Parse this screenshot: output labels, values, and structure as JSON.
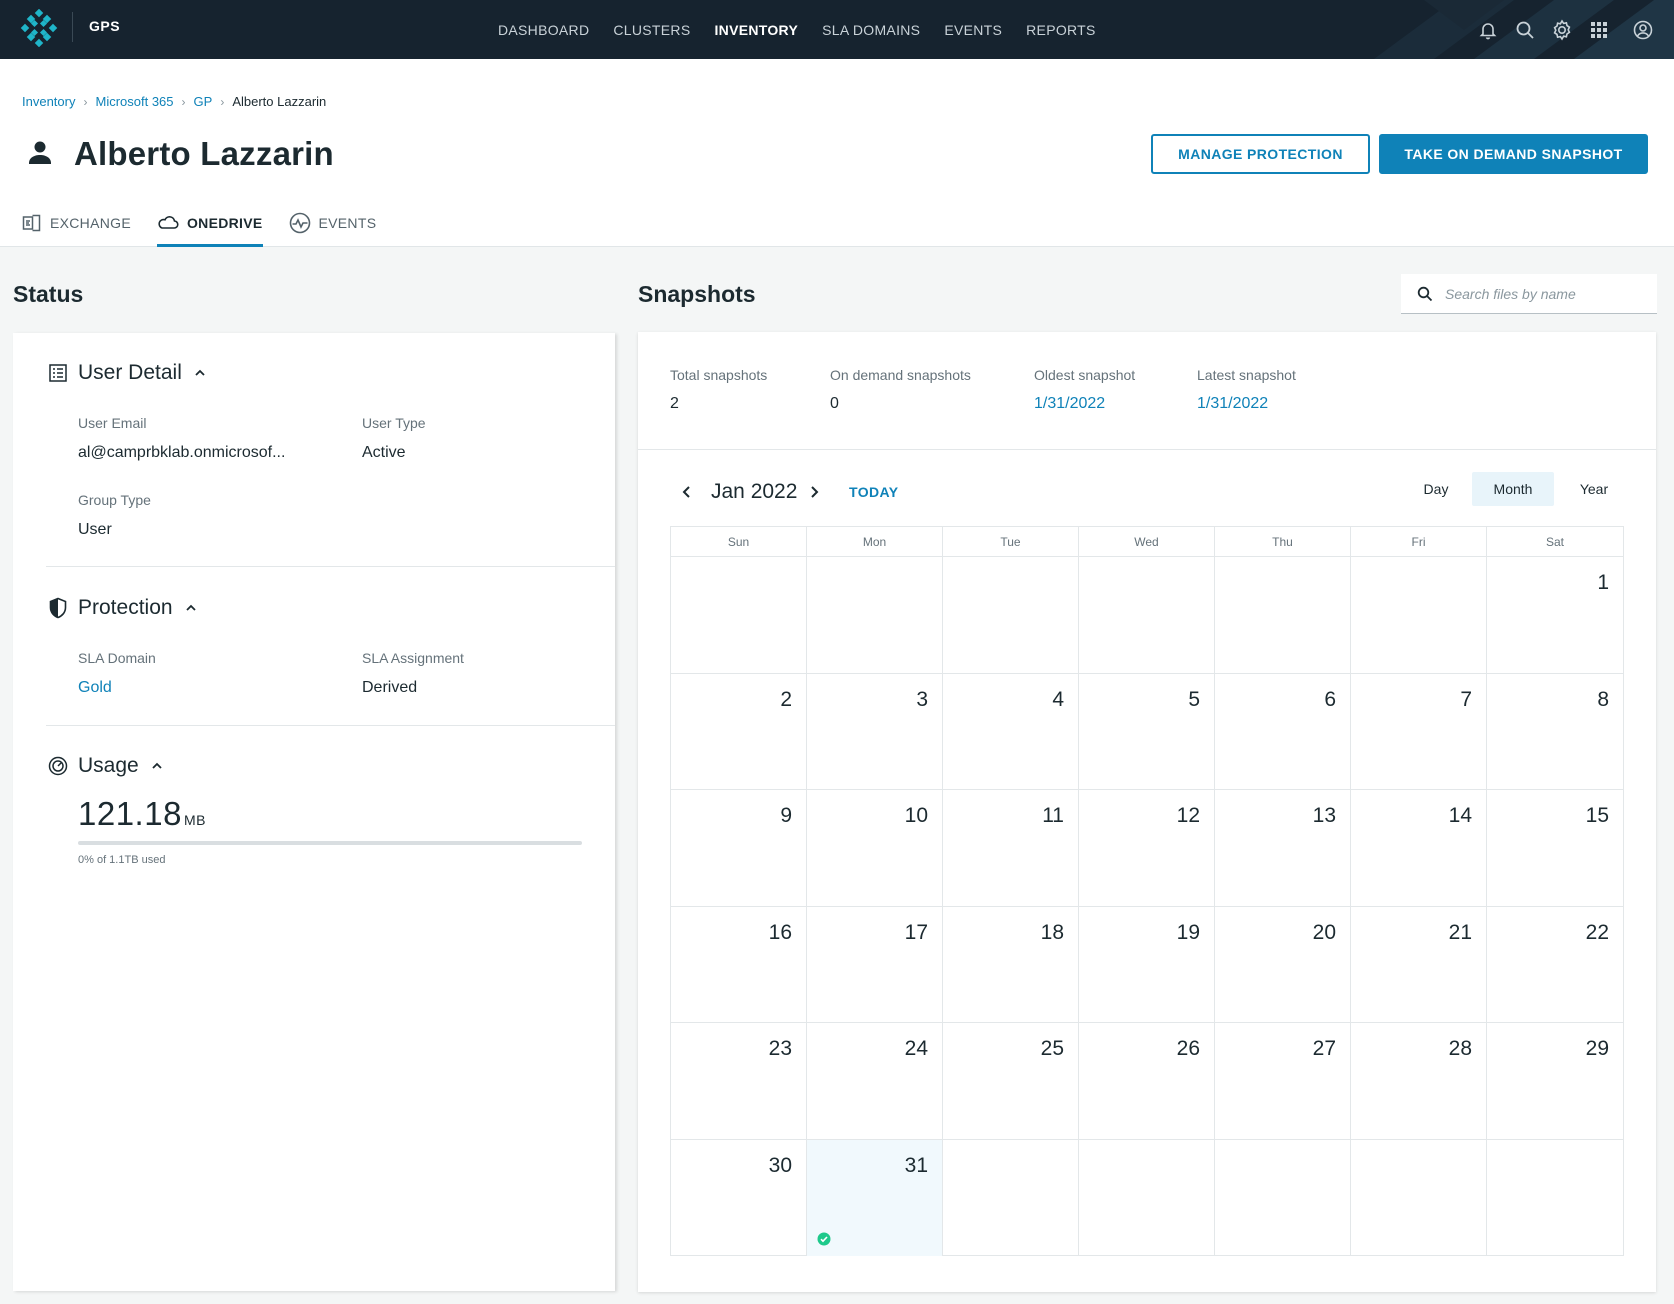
{
  "topnav": {
    "brand": "GPS",
    "items": [
      "DASHBOARD",
      "CLUSTERS",
      "INVENTORY",
      "SLA DOMAINS",
      "EVENTS",
      "REPORTS"
    ],
    "active_item": "INVENTORY",
    "icons": [
      "bell-icon",
      "search-icon",
      "gear-icon",
      "apps-grid-icon",
      "account-icon"
    ]
  },
  "breadcrumb": {
    "items": [
      "Inventory",
      "Microsoft 365",
      "GP"
    ],
    "current": "Alberto Lazzarin"
  },
  "header": {
    "title": "Alberto Lazzarin",
    "manage_button": "MANAGE PROTECTION",
    "snapshot_button": "TAKE ON DEMAND SNAPSHOT"
  },
  "tabs": [
    {
      "label": "EXCHANGE",
      "icon": "exchange-icon"
    },
    {
      "label": "ONEDRIVE",
      "icon": "onedrive-icon",
      "active": true
    },
    {
      "label": "EVENTS",
      "icon": "activity-icon"
    }
  ],
  "status": {
    "title": "Status",
    "user_detail": {
      "heading": "User Detail",
      "email_label": "User Email",
      "email_value": "al@camprbklab.onmicrosof...",
      "type_label": "User Type",
      "type_value": "Active",
      "group_label": "Group Type",
      "group_value": "User"
    },
    "protection": {
      "heading": "Protection",
      "sla_label": "SLA Domain",
      "sla_value": "Gold",
      "assignment_label": "SLA Assignment",
      "assignment_value": "Derived"
    },
    "usage": {
      "heading": "Usage",
      "value": "121.18",
      "unit": "MB",
      "percent_used": 0,
      "caption": "0% of 1.1TB used"
    }
  },
  "snapshots": {
    "title": "Snapshots",
    "search_placeholder": "Search files by name",
    "stats": {
      "total_label": "Total snapshots",
      "total_value": "2",
      "ondemand_label": "On demand snapshots",
      "ondemand_value": "0",
      "oldest_label": "Oldest snapshot",
      "oldest_value": "1/31/2022",
      "latest_label": "Latest snapshot",
      "latest_value": "1/31/2022"
    },
    "calendar": {
      "month_label": "Jan 2022",
      "today_label": "TODAY",
      "views": [
        "Day",
        "Month",
        "Year"
      ],
      "active_view": "Month",
      "weekdays": [
        "Sun",
        "Mon",
        "Tue",
        "Wed",
        "Thu",
        "Fri",
        "Sat"
      ],
      "first_weekday_index": 6,
      "days_in_month": 31,
      "weeks": 6,
      "highlighted_day": 31,
      "snapshot_days": [
        31
      ]
    }
  }
}
